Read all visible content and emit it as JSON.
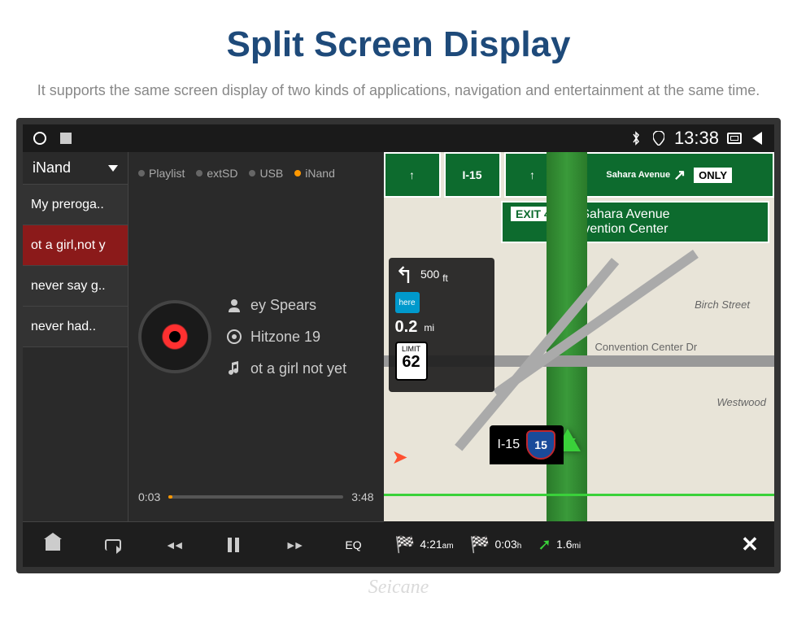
{
  "header": {
    "title": "Split Screen Display",
    "subtitle": "It supports the same screen display of two kinds of applications, navigation and entertainment at the same time."
  },
  "status_bar": {
    "time": "13:38"
  },
  "media": {
    "source": "iNand",
    "tabs": [
      "Playlist",
      "extSD",
      "USB",
      "iNand"
    ],
    "active_tab": "iNand",
    "tracks": [
      "My preroga..",
      "ot a girl,not y",
      "never say g..",
      "never had.."
    ],
    "active_track_index": 1,
    "now_playing": {
      "artist": "ey Spears",
      "album": "Hitzone 19",
      "title": "ot a girl not yet"
    },
    "elapsed": "0:03",
    "total": "3:48",
    "eq_label": "EQ"
  },
  "nav": {
    "top_route": "I-15",
    "top_street": "Sahara Avenue",
    "only_label": "ONLY",
    "exit": {
      "badge": "EXIT 40",
      "line1": "» Sahara Avenue",
      "line2": "Convention Center"
    },
    "turn_distance_ft": "500",
    "turn_distance_ft_unit": "ft",
    "next_distance": "0.2",
    "next_distance_unit": "mi",
    "speed_limit_label": "LIMIT",
    "speed_limit": "62",
    "here_label": "here",
    "current_road": "I-15",
    "shield": "15",
    "streets": {
      "birch": "Birch Street",
      "westwood": "Westwood",
      "garden": "Convention Center Dr"
    },
    "bottom": {
      "arrive": "4:21",
      "arrive_unit": "am",
      "trip_time": "0:03",
      "trip_time_unit": "h",
      "remaining": "1.6",
      "remaining_unit": "mi"
    }
  },
  "watermark": "Seicane"
}
